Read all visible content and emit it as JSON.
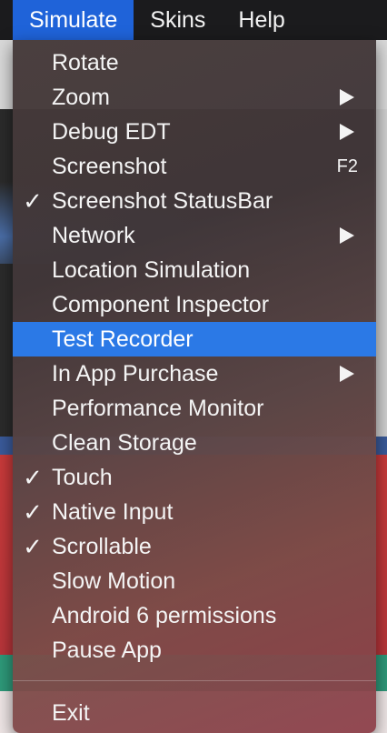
{
  "menubar": {
    "items": [
      {
        "label": "Simulate",
        "active": true
      },
      {
        "label": "Skins",
        "active": false
      },
      {
        "label": "Help",
        "active": false
      }
    ]
  },
  "menu": {
    "check_glyph": "✓",
    "items": [
      {
        "label": "Rotate",
        "checked": false,
        "submenu": false,
        "shortcut": ""
      },
      {
        "label": "Zoom",
        "checked": false,
        "submenu": true,
        "shortcut": ""
      },
      {
        "label": "Debug EDT",
        "checked": false,
        "submenu": true,
        "shortcut": ""
      },
      {
        "label": "Screenshot",
        "checked": false,
        "submenu": false,
        "shortcut": "F2"
      },
      {
        "label": "Screenshot StatusBar",
        "checked": true,
        "submenu": false,
        "shortcut": ""
      },
      {
        "label": "Network",
        "checked": false,
        "submenu": true,
        "shortcut": ""
      },
      {
        "label": "Location Simulation",
        "checked": false,
        "submenu": false,
        "shortcut": ""
      },
      {
        "label": "Component Inspector",
        "checked": false,
        "submenu": false,
        "shortcut": ""
      },
      {
        "label": "Test Recorder",
        "checked": false,
        "submenu": false,
        "shortcut": "",
        "selected": true
      },
      {
        "label": "In App Purchase",
        "checked": false,
        "submenu": true,
        "shortcut": ""
      },
      {
        "label": "Performance Monitor",
        "checked": false,
        "submenu": false,
        "shortcut": ""
      },
      {
        "label": "Clean Storage",
        "checked": false,
        "submenu": false,
        "shortcut": ""
      },
      {
        "label": "Touch",
        "checked": true,
        "submenu": false,
        "shortcut": ""
      },
      {
        "label": "Native Input",
        "checked": true,
        "submenu": false,
        "shortcut": ""
      },
      {
        "label": "Scrollable",
        "checked": true,
        "submenu": false,
        "shortcut": ""
      },
      {
        "label": "Slow Motion",
        "checked": false,
        "submenu": false,
        "shortcut": ""
      },
      {
        "label": "Android 6 permissions",
        "checked": false,
        "submenu": false,
        "shortcut": ""
      },
      {
        "label": "Pause App",
        "checked": false,
        "submenu": false,
        "shortcut": ""
      }
    ],
    "exit_label": "Exit"
  },
  "colors": {
    "menubar_active": "#1f63d9",
    "selected_item": "#2b79e6"
  }
}
